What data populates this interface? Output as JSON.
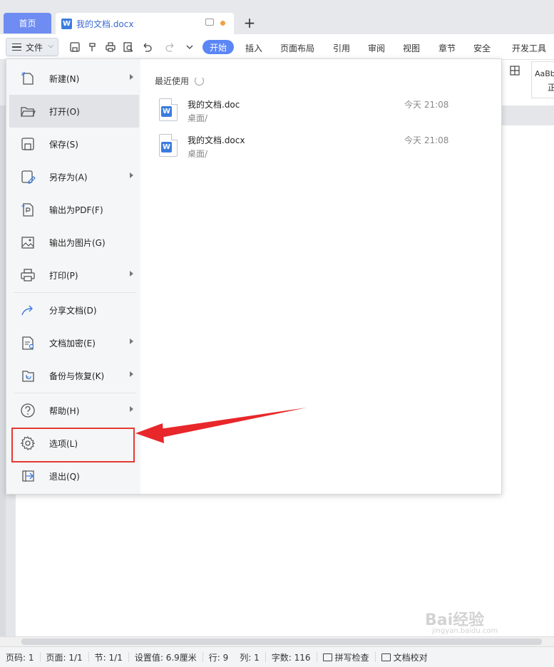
{
  "tabs": {
    "home": "首页",
    "document": "我的文档.docx",
    "add": "+"
  },
  "toolbar": {
    "file_label": "文件",
    "start_label": "开始",
    "menu_tabs": [
      "插入",
      "页面布局",
      "引用",
      "审阅",
      "视图",
      "章节",
      "安全",
      "开发工具"
    ]
  },
  "ribbon": {
    "style_preview": "AaBb",
    "style_name": "正"
  },
  "file_menu": {
    "items": [
      {
        "label": "新建(N)",
        "icon": "new-icon",
        "has_submenu": true
      },
      {
        "label": "打开(O)",
        "icon": "open-folder-icon",
        "has_submenu": false,
        "active": true
      },
      {
        "label": "保存(S)",
        "icon": "save-icon",
        "has_submenu": false
      },
      {
        "label": "另存为(A)",
        "icon": "save-as-icon",
        "has_submenu": true
      },
      {
        "label": "输出为PDF(F)",
        "icon": "pdf-export-icon",
        "has_submenu": false
      },
      {
        "label": "输出为图片(G)",
        "icon": "image-export-icon",
        "has_submenu": false
      },
      {
        "label": "打印(P)",
        "icon": "print-icon",
        "has_submenu": true
      },
      {
        "label": "分享文档(D)",
        "icon": "share-icon",
        "has_submenu": false
      },
      {
        "label": "文档加密(E)",
        "icon": "encrypt-icon",
        "has_submenu": true
      },
      {
        "label": "备份与恢复(K)",
        "icon": "backup-icon",
        "has_submenu": true
      },
      {
        "label": "帮助(H)",
        "icon": "help-icon",
        "has_submenu": true
      },
      {
        "label": "选项(L)",
        "icon": "gear-icon",
        "has_submenu": false,
        "highlighted": true
      },
      {
        "label": "退出(Q)",
        "icon": "exit-icon",
        "has_submenu": false
      }
    ],
    "recent_title": "最近使用",
    "recent_files": [
      {
        "name": "我的文档.doc",
        "path": "桌面/",
        "time": "今天 21:08"
      },
      {
        "name": "我的文档.docx",
        "path": "桌面/",
        "time": "今天 21:08"
      }
    ]
  },
  "statusbar": {
    "page_no": "页码: 1",
    "page": "页面: 1/1",
    "section": "节: 1/1",
    "setting": "设置值: 6.9厘米",
    "row": "行: 9",
    "col": "列: 1",
    "words": "字数: 116",
    "spellcheck": "拼写检查",
    "proofread": "文档校对"
  },
  "watermark": {
    "text": "Bai经验",
    "url": "jingyan.baidu.com"
  },
  "colors": {
    "accent": "#5b86f5",
    "highlight_border": "#e53935",
    "word_blue": "#3b7bdf"
  }
}
